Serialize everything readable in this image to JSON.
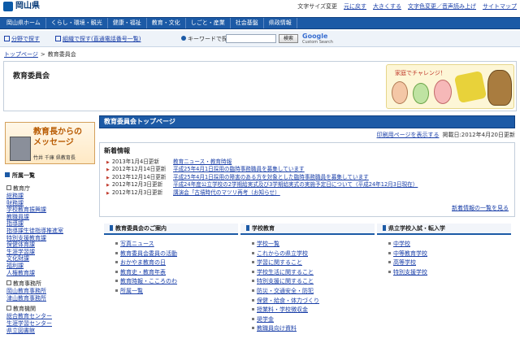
{
  "header": {
    "logo_text": "岡山県",
    "util_links": [
      "文字サイズ変更",
      "元に戻す",
      "大きくする",
      "文字色変更／音声読み上げ",
      "サイトマップ"
    ]
  },
  "nav": {
    "items": [
      "岡山県ホーム",
      "くらし・環境・観光",
      "健康・福祉",
      "教育・文化",
      "しごと・産業",
      "社会基盤",
      "県政情報"
    ]
  },
  "search": {
    "links": [
      "分野で探す",
      "組織で探す(直通電話番号一覧)"
    ],
    "keyword_label": "キーワードで探す",
    "button_label": "検索",
    "google_label": "Google",
    "google_sub": "Custom Search"
  },
  "breadcrumb": {
    "home": "トップページ",
    "separator": ">",
    "current": "教育委員会"
  },
  "page": {
    "title": "教育委員会",
    "mascot_text": "家庭でチャレンジ！"
  },
  "sidebar": {
    "superintendent": {
      "line1": "教育長からの",
      "line2": "メッセージ",
      "name": "竹井 千庫 県教育長"
    },
    "index_heading": "所属一覧",
    "groups": [
      {
        "label": "教育庁",
        "items": [
          "総務課",
          "財務課",
          "学校教育振興課",
          "教職員課",
          "指導課",
          "指導課生徒指導推進室",
          "特別支援教育課",
          "保健体育課",
          "生涯学習課",
          "文化財課",
          "福利課",
          "人権教育課"
        ]
      },
      {
        "label": "教育事務所",
        "items": [
          "岡山教育事務所",
          "津山教育事務所"
        ]
      },
      {
        "label": "教育機関",
        "items": [
          "総合教育センター",
          "生涯学習センター",
          "県立図書館"
        ]
      }
    ]
  },
  "main": {
    "heading": "教育委員会トップページ",
    "print_link": "印刷用ページを表示する",
    "post_date": "掲載日:2012年4月20日更新",
    "news": {
      "heading": "新着情報",
      "items": [
        {
          "date": "2013年1月4日更新",
          "text": "教育ニュース・教育時報"
        },
        {
          "date": "2012年12月14日更新",
          "text": "平成25年4月1日採用の臨時事務職員を募集しています"
        },
        {
          "date": "2012年12月14日更新",
          "text": "平成25年4月1日採用の障害のある方を対象とした臨時事務職員を募集しています"
        },
        {
          "date": "2012年12月3日更新",
          "text": "平成24年度公立学校の2学期給実式及び3学期給実式の実施予定日について（平成24年12月3日現在）"
        },
        {
          "date": "2012年12月3日更新",
          "text": "講演会「古墳時代のマツリ再考（お知らせ）"
        }
      ],
      "more": "新着情報の一覧を見る"
    },
    "columns": [
      {
        "heading": "教育委員会のご案内",
        "links": [
          "写真ニュース",
          "教育委員会委員の活動",
          "おかやま教育の日",
          "教育史・教育年表",
          "教育時報・こころのわ",
          "所属一覧"
        ]
      },
      {
        "heading": "学校教育",
        "links": [
          "学校一覧",
          "これからの県立学校",
          "学習に関すること",
          "学校生活に関すること",
          "特別支援に関すること",
          "防災・交通安全・防犯",
          "保健・給食・体力づくり",
          "授業料・学校徴収金",
          "奨学金",
          "教職員向け資料"
        ]
      },
      {
        "heading": "県立学校入試・転入学",
        "links": [
          "中学校",
          "中等教育学校",
          "高等学校",
          "特別支援学校"
        ]
      }
    ]
  }
}
